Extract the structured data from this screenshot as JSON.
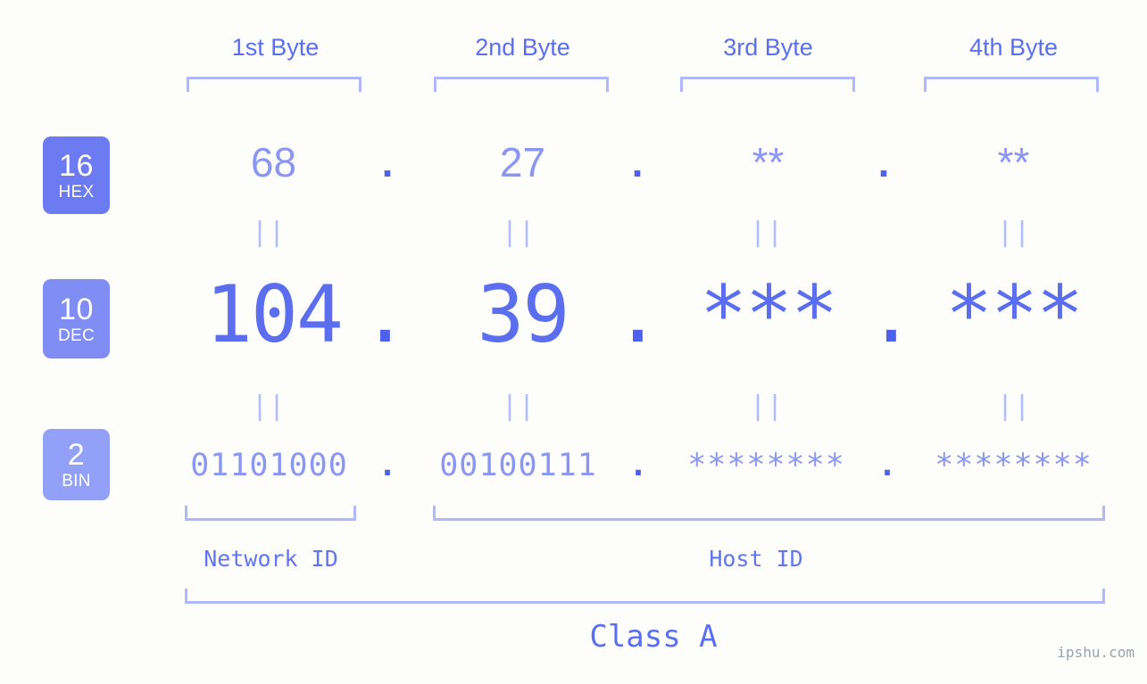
{
  "meta": {
    "background_color": "#fdfefb",
    "accent_color": "#5b6ef0",
    "accent_light_color": "#8b96f2",
    "bracket_color": "#aeb8fb",
    "watermark": "ipshu.com"
  },
  "byte_headers": [
    {
      "label": "1st Byte"
    },
    {
      "label": "2nd Byte"
    },
    {
      "label": "3rd Byte"
    },
    {
      "label": "4th Byte"
    }
  ],
  "bases": [
    {
      "number": "16",
      "name": "HEX",
      "color": "#6d7bf2"
    },
    {
      "number": "10",
      "name": "DEC",
      "color": "#808df5"
    },
    {
      "number": "2",
      "name": "BIN",
      "color": "#92a1f7"
    }
  ],
  "rows": {
    "hex": {
      "base_number": "16",
      "base_name": "HEX",
      "values": [
        "68",
        "27",
        "**",
        "**"
      ],
      "separator": "."
    },
    "dec": {
      "base_number": "10",
      "base_name": "DEC",
      "values": [
        "104",
        "39",
        "***",
        "***"
      ],
      "separator": "."
    },
    "bin": {
      "base_number": "2",
      "base_name": "BIN",
      "values": [
        "01101000",
        "00100111",
        "********",
        "********"
      ],
      "separator": "."
    }
  },
  "connectors": {
    "symbol": "||",
    "count_per_row": 4
  },
  "id_sections": [
    {
      "label": "Network ID"
    },
    {
      "label": "Host ID"
    }
  ],
  "class_section": {
    "label": "Class A"
  }
}
